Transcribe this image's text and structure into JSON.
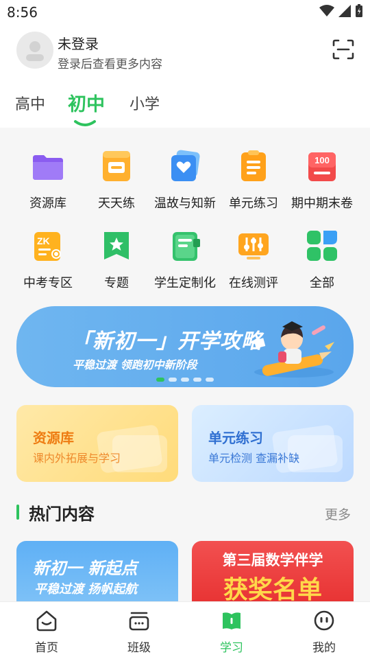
{
  "status_bar": {
    "time": "8:56"
  },
  "user": {
    "name": "未登录",
    "subtitle": "登录后查看更多内容"
  },
  "tabs": [
    {
      "label": "高中",
      "active": false
    },
    {
      "label": "初中",
      "active": true
    },
    {
      "label": "小学",
      "active": false
    }
  ],
  "grid_items": [
    {
      "label": "资源库",
      "icon": "folder-icon"
    },
    {
      "label": "天天练",
      "icon": "daily-practice-icon"
    },
    {
      "label": "温故与知新",
      "icon": "review-heart-icon"
    },
    {
      "label": "单元练习",
      "icon": "unit-exercise-icon"
    },
    {
      "label": "期中期末卷",
      "icon": "exam-100-icon"
    },
    {
      "label": "中考专区",
      "icon": "zk-exam-icon"
    },
    {
      "label": "专题",
      "icon": "topic-star-icon"
    },
    {
      "label": "学生定制化",
      "icon": "custom-book-icon"
    },
    {
      "label": "在线测评",
      "icon": "online-test-icon"
    },
    {
      "label": "全部",
      "icon": "all-apps-icon"
    }
  ],
  "banner": {
    "title": "「新初一」开学攻略",
    "subtitle": "平稳过渡 领跑初中新阶段"
  },
  "promo_cards": [
    {
      "title": "资源库",
      "subtitle": "课内外拓展与学习"
    },
    {
      "title": "单元练习",
      "subtitle": "单元检测 查漏补缺"
    }
  ],
  "hot": {
    "title": "热门内容",
    "more": "更多"
  },
  "hot_cards": [
    {
      "line1": "新初一 新起点",
      "line2": "平稳过渡 扬帆起航"
    },
    {
      "line1": "第三届数学伴学",
      "line2": "获奖名单"
    }
  ],
  "nav": [
    {
      "label": "首页",
      "icon": "home-icon",
      "active": false
    },
    {
      "label": "班级",
      "icon": "class-icon",
      "active": false
    },
    {
      "label": "学习",
      "icon": "study-icon",
      "active": true
    },
    {
      "label": "我的",
      "icon": "profile-icon",
      "active": false
    }
  ],
  "colors": {
    "accent": "#2ec35e",
    "resource_orange": "#ee7c12",
    "unit_blue": "#2f6fd1"
  }
}
